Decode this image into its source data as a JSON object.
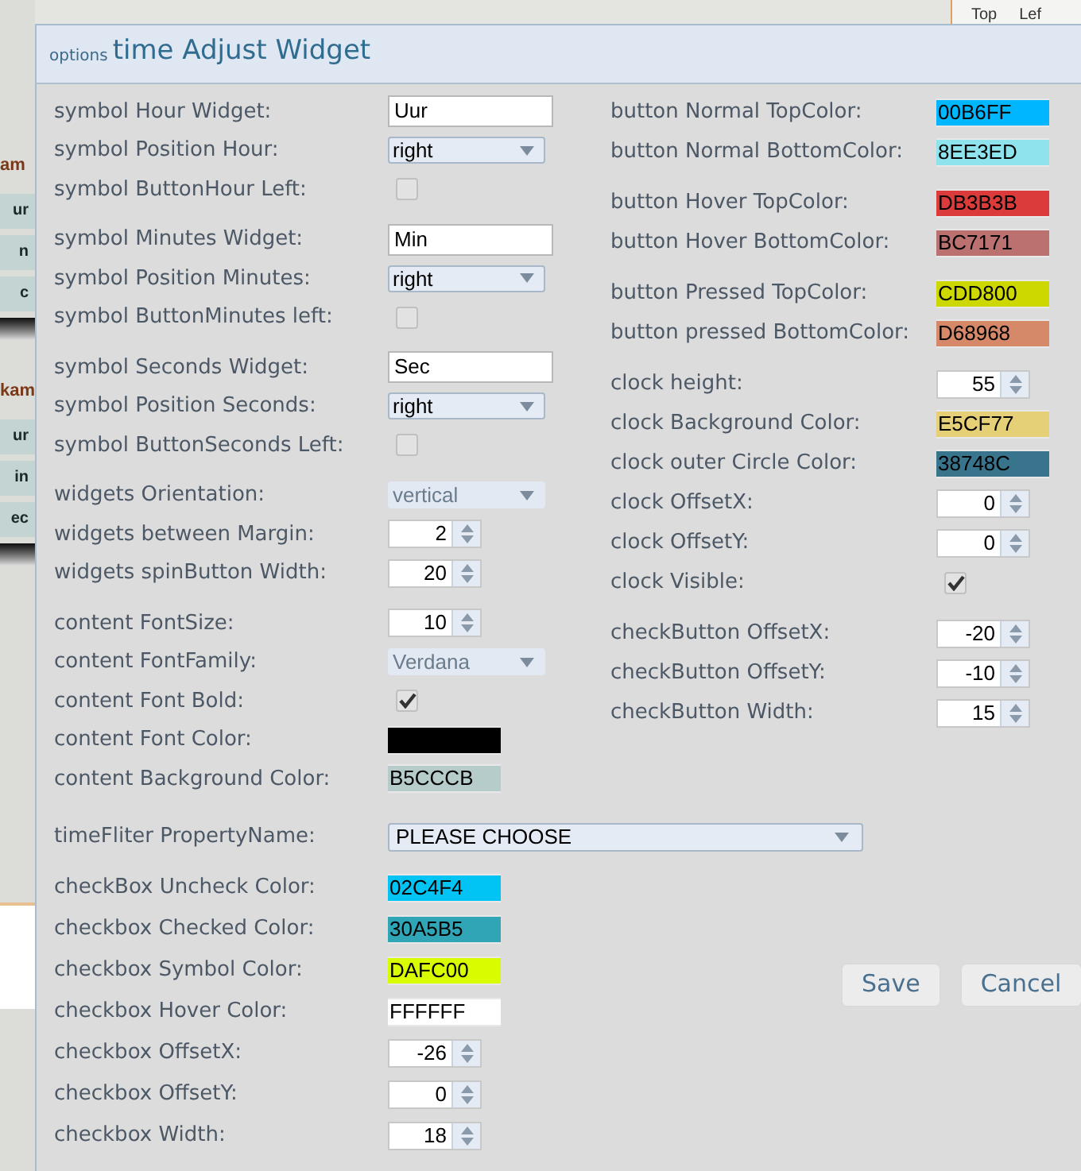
{
  "background": {
    "left_items": [
      {
        "text": "am",
        "kind": "heading"
      },
      {
        "text": "ur",
        "kind": "tile"
      },
      {
        "text": "n",
        "kind": "tile"
      },
      {
        "text": "c",
        "kind": "tile"
      },
      {
        "text": "kam",
        "kind": "heading"
      },
      {
        "text": "ur",
        "kind": "tile"
      },
      {
        "text": "in",
        "kind": "tile"
      },
      {
        "text": "ec",
        "kind": "tile"
      }
    ],
    "top_right": [
      "Top",
      "Lef"
    ]
  },
  "dialog": {
    "title_prefix": "options",
    "title": "time Adjust Widget",
    "left_groups": [
      [
        {
          "label": "symbol Hour Widget:",
          "kind": "text",
          "value": "Uur"
        },
        {
          "label": "symbol Position Hour:",
          "kind": "select",
          "value": "right",
          "disabled": false
        },
        {
          "label": "symbol ButtonHour Left:",
          "kind": "checkbox",
          "checked": false
        }
      ],
      [
        {
          "label": "symbol Minutes Widget:",
          "kind": "text",
          "value": "Min"
        },
        {
          "label": "symbol Position Minutes:",
          "kind": "select",
          "value": "right",
          "disabled": false
        },
        {
          "label": "symbol ButtonMinutes left:",
          "kind": "checkbox",
          "checked": false
        }
      ],
      [
        {
          "label": "symbol Seconds Widget:",
          "kind": "text",
          "value": "Sec"
        },
        {
          "label": "symbol Position Seconds:",
          "kind": "select",
          "value": "right",
          "disabled": false
        },
        {
          "label": "symbol ButtonSeconds Left:",
          "kind": "checkbox",
          "checked": false
        }
      ],
      [
        {
          "label": "widgets Orientation:",
          "kind": "select",
          "value": "vertical",
          "disabled": true
        },
        {
          "label": "widgets between Margin:",
          "kind": "spin",
          "value": "2"
        },
        {
          "label": "widgets spinButton Width:",
          "kind": "spin",
          "value": "20"
        }
      ],
      [
        {
          "label": "content FontSize:",
          "kind": "spin",
          "value": "10"
        },
        {
          "label": "content FontFamily:",
          "kind": "select",
          "value": "Verdana",
          "disabled": true
        },
        {
          "label": "content Font Bold:",
          "kind": "checkbox",
          "checked": true
        },
        {
          "label": "content Font Color:",
          "kind": "color",
          "color": "#000000"
        },
        {
          "label": "content Background Color:",
          "kind": "color",
          "value": "B5CCCB",
          "color": "#b5cccb"
        }
      ]
    ],
    "right_groups": [
      [
        {
          "label": "button Normal TopColor:",
          "kind": "color",
          "value": "00B6FF",
          "color": "#00b6ff"
        },
        {
          "label": "button Normal BottomColor:",
          "kind": "color",
          "value": "8EE3ED",
          "color": "#8ee3ed"
        }
      ],
      [
        {
          "label": "button Hover TopColor:",
          "kind": "color",
          "value": "DB3B3B",
          "color": "#db3b3b"
        },
        {
          "label": "button Hover BottomColor:",
          "kind": "color",
          "value": "BC7171",
          "color": "#bc7171"
        }
      ],
      [
        {
          "label": "button Pressed TopColor:",
          "kind": "color",
          "value": "CDD800",
          "color": "#cdd800"
        },
        {
          "label": "button pressed BottomColor:",
          "kind": "color",
          "value": "D68968",
          "color": "#d68968"
        }
      ],
      [
        {
          "label": "clock height:",
          "kind": "spin",
          "value": "55"
        },
        {
          "label": "clock Background Color:",
          "kind": "color",
          "value": "E5CF77",
          "color": "#e5cf77"
        },
        {
          "label": "clock outer Circle Color:",
          "kind": "color",
          "value": "38748C",
          "color": "#38748c"
        },
        {
          "label": "clock OffsetX:",
          "kind": "spin",
          "value": "0"
        },
        {
          "label": "clock OffsetY:",
          "kind": "spin",
          "value": "0"
        },
        {
          "label": "clock Visible:",
          "kind": "checkbox",
          "checked": true
        }
      ],
      [
        {
          "label": "checkButton OffsetX:",
          "kind": "spin",
          "value": "-20"
        },
        {
          "label": "checkButton OffsetY:",
          "kind": "spin",
          "value": "-10"
        },
        {
          "label": "checkButton Width:",
          "kind": "spin",
          "value": "15"
        }
      ]
    ],
    "filter": {
      "label": "timeFliter PropertyName:",
      "value": "PLEASE CHOOSE"
    },
    "bottom_group": [
      {
        "label": "checkBox Uncheck Color:",
        "kind": "color",
        "value": "02C4F4",
        "color": "#02c4f4"
      },
      {
        "label": "checkbox Checked Color:",
        "kind": "color",
        "value": "30A5B5",
        "color": "#30a5b5"
      },
      {
        "label": "checkbox Symbol Color:",
        "kind": "color",
        "value": "DAFC00",
        "color": "#dafc00"
      },
      {
        "label": "checkbox Hover Color:",
        "kind": "color",
        "value": "FFFFFF",
        "color": "#ffffff"
      },
      {
        "label": "checkbox OffsetX:",
        "kind": "spin",
        "value": "-26"
      },
      {
        "label": "checkbox OffsetY:",
        "kind": "spin",
        "value": "0"
      },
      {
        "label": "checkbox Width:",
        "kind": "spin",
        "value": "18"
      }
    ],
    "buttons": [
      {
        "label": "Save"
      },
      {
        "label": "Cancel"
      }
    ]
  }
}
